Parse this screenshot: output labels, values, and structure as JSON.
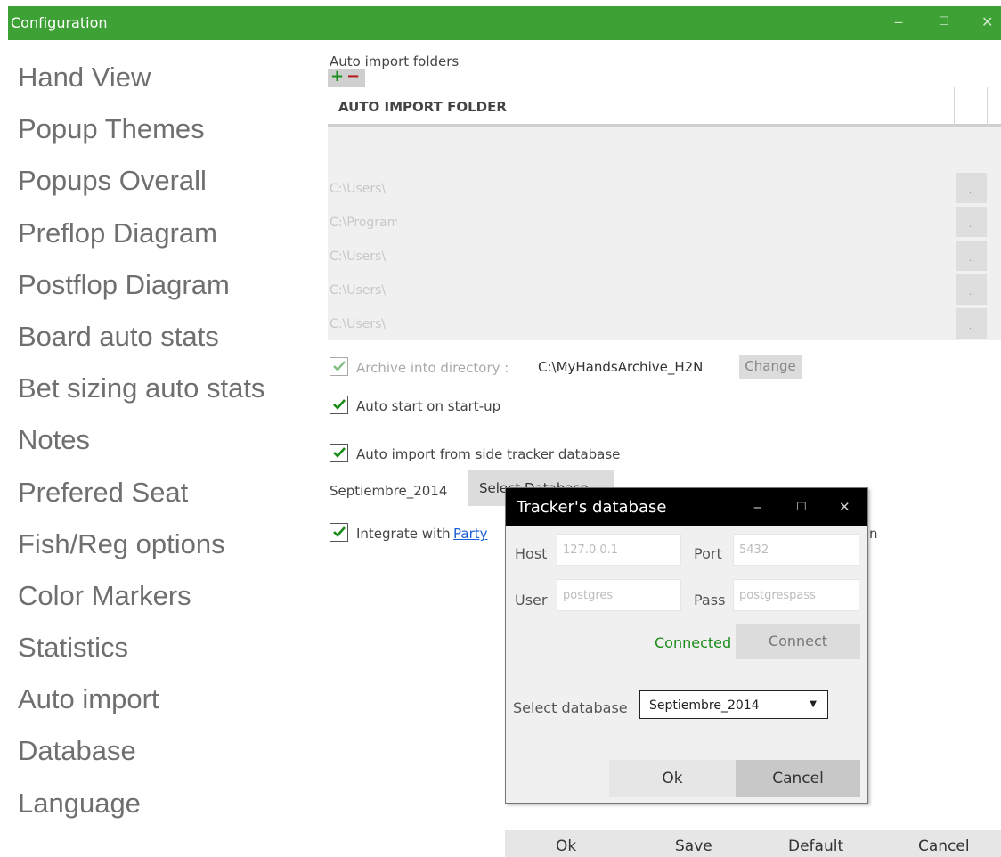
{
  "window": {
    "title": "Configuration",
    "minimize": "‒",
    "maximize": "☐",
    "close": "✕"
  },
  "sidebar": {
    "items": [
      {
        "label": "Hand View"
      },
      {
        "label": "Popup Themes"
      },
      {
        "label": "Popups Overall"
      },
      {
        "label": "Preflop Diagram"
      },
      {
        "label": "Postflop Diagram"
      },
      {
        "label": "Board auto stats"
      },
      {
        "label": "Bet sizing auto stats"
      },
      {
        "label": "Notes"
      },
      {
        "label": "Prefered Seat"
      },
      {
        "label": "Fish/Reg options"
      },
      {
        "label": "Color Markers"
      },
      {
        "label": "Statistics"
      },
      {
        "label": "Auto import"
      },
      {
        "label": "Database"
      },
      {
        "label": "Language"
      }
    ]
  },
  "main": {
    "section_label": "Auto import folders",
    "add": "+",
    "remove": "−",
    "table": {
      "header": "AUTO IMPORT FOLDER",
      "rows": [
        {
          "path": "C:\\Users\\",
          "browse": ".."
        },
        {
          "path": "C:\\Program",
          "browse": ".."
        },
        {
          "path": "C:\\Users\\",
          "browse": ".."
        },
        {
          "path": "C:\\Users\\",
          "browse": ".."
        },
        {
          "path": "C:\\Users\\",
          "browse": ".."
        }
      ]
    },
    "archive": {
      "label": "Archive into directory :",
      "path": "C:\\MyHandsArchive_H2N",
      "change": "Change",
      "checked": true
    },
    "auto_start": {
      "label": "Auto start on start-up",
      "checked": true
    },
    "side_tracker": {
      "label": "Auto import from side tracker database",
      "checked": true
    },
    "database_name": "Septiembre_2014",
    "select_database_button": "Select Database",
    "integrate": {
      "label": "Integrate with",
      "link": "Party",
      "suffix": "n",
      "checked": true
    }
  },
  "bottom_bar": {
    "ok": "Ok",
    "save": "Save",
    "default": "Default",
    "cancel": "Cancel"
  },
  "dialog": {
    "title": "Tracker's database",
    "minimize": "‒",
    "maximize": "☐",
    "close": "✕",
    "host_label": "Host",
    "host_value": "127.0.0.1",
    "port_label": "Port",
    "port_value": "5432",
    "user_label": "User",
    "user_value": "postgres",
    "pass_label": "Pass",
    "pass_value": "postgrespass",
    "status": "Connected",
    "connect": "Connect",
    "select_db_label": "Select database",
    "select_db_value": "Septiembre_2014",
    "ok": "Ok",
    "cancel": "Cancel"
  },
  "colors": {
    "titlebar": "#3ea135",
    "status_connected": "#1a8c1a",
    "link": "#1b5fd8",
    "dialog_titlebar": "#000000"
  }
}
